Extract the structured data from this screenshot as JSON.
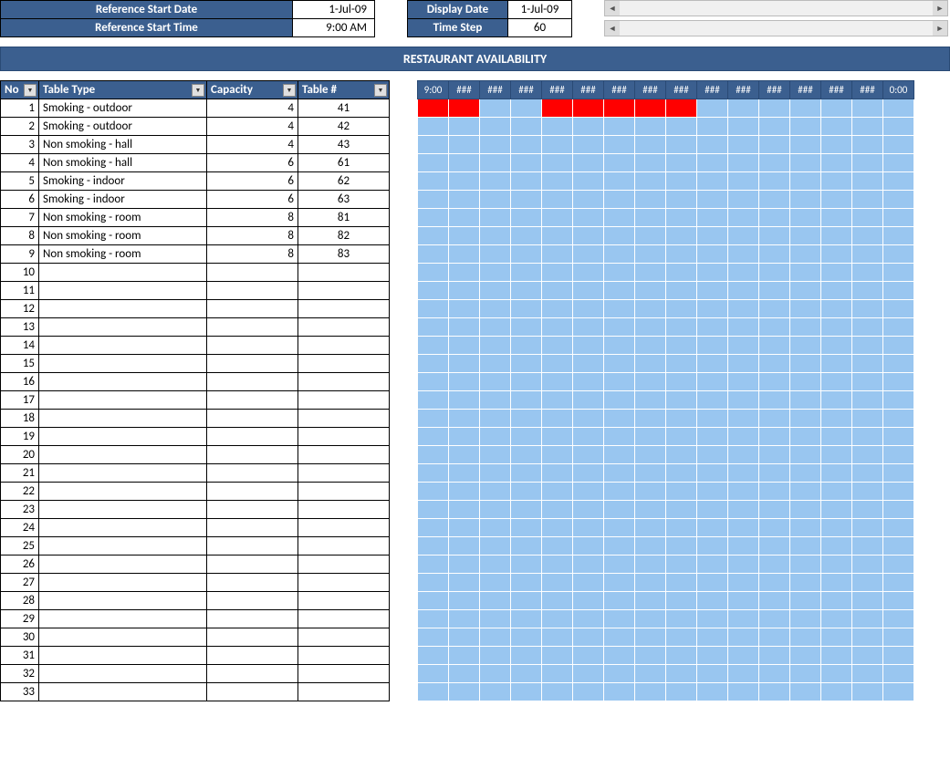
{
  "params": {
    "ref_start_date_label": "Reference Start Date",
    "ref_start_date_value": "1-Jul-09",
    "ref_start_time_label": "Reference Start Time",
    "ref_start_time_value": "9:00 AM",
    "display_date_label": "Display Date",
    "display_date_value": "1-Jul-09",
    "time_step_label": "Time Step",
    "time_step_value": "60"
  },
  "title": "RESTAURANT AVAILABILITY",
  "columns": {
    "no": "No",
    "table_type": "Table Type",
    "capacity": "Capacity",
    "table_num": "Table #"
  },
  "rows": [
    {
      "no": "1",
      "type": "Smoking - outdoor",
      "cap": "4",
      "tnum": "41"
    },
    {
      "no": "2",
      "type": "Smoking - outdoor",
      "cap": "4",
      "tnum": "42"
    },
    {
      "no": "3",
      "type": "Non smoking - hall",
      "cap": "4",
      "tnum": "43"
    },
    {
      "no": "4",
      "type": "Non smoking - hall",
      "cap": "6",
      "tnum": "61"
    },
    {
      "no": "5",
      "type": "Smoking - indoor",
      "cap": "6",
      "tnum": "62"
    },
    {
      "no": "6",
      "type": "Smoking - indoor",
      "cap": "6",
      "tnum": "63"
    },
    {
      "no": "7",
      "type": "Non smoking - room",
      "cap": "8",
      "tnum": "81"
    },
    {
      "no": "8",
      "type": "Non smoking - room",
      "cap": "8",
      "tnum": "82"
    },
    {
      "no": "9",
      "type": "Non smoking - room",
      "cap": "8",
      "tnum": "83"
    },
    {
      "no": "10",
      "type": "",
      "cap": "",
      "tnum": ""
    },
    {
      "no": "11",
      "type": "",
      "cap": "",
      "tnum": ""
    },
    {
      "no": "12",
      "type": "",
      "cap": "",
      "tnum": ""
    },
    {
      "no": "13",
      "type": "",
      "cap": "",
      "tnum": ""
    },
    {
      "no": "14",
      "type": "",
      "cap": "",
      "tnum": ""
    },
    {
      "no": "15",
      "type": "",
      "cap": "",
      "tnum": ""
    },
    {
      "no": "16",
      "type": "",
      "cap": "",
      "tnum": ""
    },
    {
      "no": "17",
      "type": "",
      "cap": "",
      "tnum": ""
    },
    {
      "no": "18",
      "type": "",
      "cap": "",
      "tnum": ""
    },
    {
      "no": "19",
      "type": "",
      "cap": "",
      "tnum": ""
    },
    {
      "no": "20",
      "type": "",
      "cap": "",
      "tnum": ""
    },
    {
      "no": "21",
      "type": "",
      "cap": "",
      "tnum": ""
    },
    {
      "no": "22",
      "type": "",
      "cap": "",
      "tnum": ""
    },
    {
      "no": "23",
      "type": "",
      "cap": "",
      "tnum": ""
    },
    {
      "no": "24",
      "type": "",
      "cap": "",
      "tnum": ""
    },
    {
      "no": "25",
      "type": "",
      "cap": "",
      "tnum": ""
    },
    {
      "no": "26",
      "type": "",
      "cap": "",
      "tnum": ""
    },
    {
      "no": "27",
      "type": "",
      "cap": "",
      "tnum": ""
    },
    {
      "no": "28",
      "type": "",
      "cap": "",
      "tnum": ""
    },
    {
      "no": "29",
      "type": "",
      "cap": "",
      "tnum": ""
    },
    {
      "no": "30",
      "type": "",
      "cap": "",
      "tnum": ""
    },
    {
      "no": "31",
      "type": "",
      "cap": "",
      "tnum": ""
    },
    {
      "no": "32",
      "type": "",
      "cap": "",
      "tnum": ""
    },
    {
      "no": "33",
      "type": "",
      "cap": "",
      "tnum": ""
    }
  ],
  "time_headers": [
    "9:00",
    "###",
    "###",
    "###",
    "###",
    "###",
    "###",
    "###",
    "###",
    "###",
    "###",
    "###",
    "###",
    "###",
    "###",
    "0:00"
  ],
  "grid": {
    "row_count": 33,
    "col_count": 16,
    "booked": [
      [
        0,
        0
      ],
      [
        0,
        1
      ],
      [
        0,
        4
      ],
      [
        0,
        5
      ],
      [
        0,
        6
      ],
      [
        0,
        7
      ],
      [
        0,
        8
      ]
    ]
  }
}
